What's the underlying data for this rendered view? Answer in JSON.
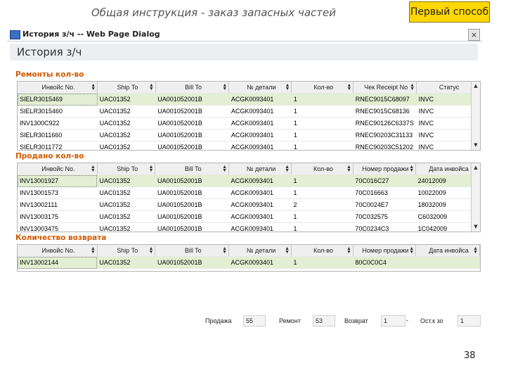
{
  "slide": {
    "title": "Общая инструкция - заказ запасных частей",
    "badge": "Первый способ",
    "page_number": "38"
  },
  "dialog": {
    "title": "История з/ч -- Web Page Dialog",
    "close_label": "×",
    "heading": "История з/ч",
    "sections": [
      {
        "label": "Ремонты кол-во",
        "columns": [
          "Инвойс No.",
          "Ship To",
          "Bill To",
          "№ детали",
          "Кол-во",
          "Чек Receipt No",
          "Статус"
        ],
        "rows": [
          [
            "SIELR3015469",
            "UAC01352",
            "UA001052001B",
            "ACGK0093401",
            "1",
            "RNEC9015C68097",
            "INVC"
          ],
          [
            "SIELR3015460",
            "UAC01352",
            "UA001052001B",
            "ACGK0093401",
            "1",
            "RNEC9015C68136",
            "INVC"
          ],
          [
            "INV1300C922",
            "UAC01352",
            "UA001052001B",
            "ACGK0093401",
            "1",
            "RNEC90126C6337S",
            "INVC"
          ],
          [
            "SIELR3011660",
            "UAC01352",
            "UA001052001B",
            "ACGK0093401",
            "1",
            "RNEC90203C31133",
            "INVC"
          ],
          [
            "SIELR3011772",
            "UAC01352",
            "UA001052001B",
            "ACGK0093401",
            "1",
            "RNEC90203C51202",
            "INVC"
          ]
        ]
      },
      {
        "label": "Продано кол-во",
        "columns": [
          "Инвойс No.",
          "Ship To",
          "Bill To",
          "№ детали",
          "Кол-во",
          "Номер продажи",
          "Дата инвойса"
        ],
        "rows": [
          [
            "INV13001927",
            "UAC01352",
            "UA001052001B",
            "ACGK0093401",
            "1",
            "70C016C27",
            "24012009"
          ],
          [
            "INV13001573",
            "UAC01352",
            "UA001052001B",
            "ACGK0093401",
            "1",
            "70C016663",
            "10022009"
          ],
          [
            "INV13002111",
            "UAC01352",
            "UA001052001B",
            "ACGK0093401",
            "2",
            "70C0024E7",
            "18032009"
          ],
          [
            "INV13003175",
            "UAC01352",
            "UA001052001B",
            "ACGK0093401",
            "1",
            "70C032575",
            "C6032009"
          ],
          [
            "INV13003475",
            "UAC01352",
            "UA001052001B",
            "ACGK0093401",
            "1",
            "70C0234C3",
            "1C042009"
          ]
        ]
      },
      {
        "label": "Количество возврата",
        "columns": [
          "Инвойс No.",
          "Ship To",
          "Bill To",
          "№ детали",
          "Кол-во",
          "Номер продажи",
          "Дата инвойса"
        ],
        "rows": [
          [
            "INV13002144",
            "UAC01352",
            "UA001052001B",
            "ACGK0093401",
            "1",
            "80C0C0C4",
            ""
          ]
        ]
      }
    ],
    "footer": {
      "sales_label": "Продажа",
      "sales_value": "55",
      "repair_label": "Ремонт",
      "repair_value": "53",
      "return_label": "Возврат",
      "return_value": "1",
      "separator": "-",
      "balance_label": "Ост.к зо",
      "balance_value": "1"
    }
  },
  "colors": {
    "badge": "#ffd700",
    "section_label": "#d25a00",
    "selected_row": "#e2efd2"
  },
  "icons": {
    "dialog": "ie-window-icon",
    "sort": "sort-arrows-icon",
    "scroll_up": "scroll-up-icon",
    "scroll_down": "scroll-down-icon"
  }
}
